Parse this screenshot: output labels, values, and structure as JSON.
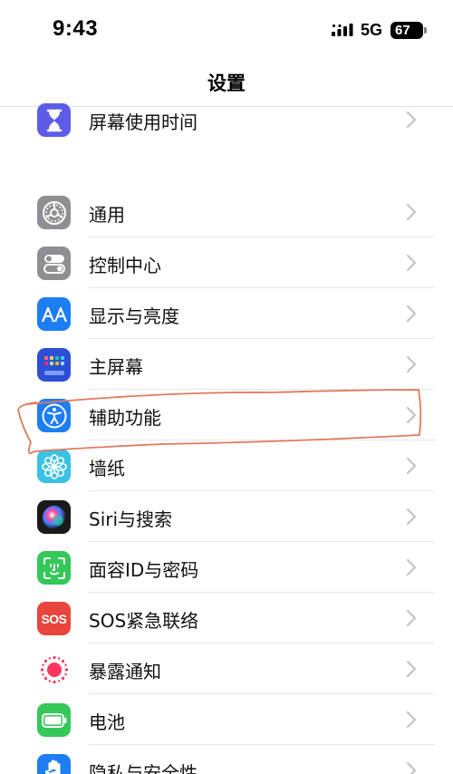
{
  "status_bar": {
    "time": "9:43",
    "network": "5G",
    "battery": "67"
  },
  "nav": {
    "title": "设置"
  },
  "groups": [
    {
      "items": [
        {
          "label": "屏幕使用时间",
          "icon": "hourglass-icon",
          "color": "#5E5CE6"
        }
      ]
    },
    {
      "items": [
        {
          "label": "通用",
          "icon": "gear-icon",
          "color": "#8E8E93"
        },
        {
          "label": "控制中心",
          "icon": "toggle-icon",
          "color": "#8E8E93"
        },
        {
          "label": "显示与亮度",
          "icon": "text-size-icon",
          "color": "#1C7EF2"
        },
        {
          "label": "主屏幕",
          "icon": "home-grid-icon",
          "color": "#2D4FD6"
        },
        {
          "label": "辅助功能",
          "icon": "accessibility-icon",
          "color": "#1C7EF2"
        },
        {
          "label": "墙纸",
          "icon": "flower-icon",
          "color": "#3AC1E3"
        },
        {
          "label": "Siri与搜索",
          "icon": "siri-icon",
          "color": "#1a1a1a"
        },
        {
          "label": "面容ID与密码",
          "icon": "face-id-icon",
          "color": "#34C759"
        },
        {
          "label": "SOS紧急联络",
          "icon": "sos-icon",
          "color": "#E8453C",
          "icon_text": "SOS"
        },
        {
          "label": "暴露通知",
          "icon": "exposure-icon",
          "color": "#ffffff"
        },
        {
          "label": "电池",
          "icon": "battery-icon",
          "color": "#34C759"
        },
        {
          "label": "隐私与安全性",
          "icon": "hand-icon",
          "color": "#1C7EF2"
        }
      ]
    }
  ],
  "annotation": {
    "color": "#E07A5F"
  }
}
